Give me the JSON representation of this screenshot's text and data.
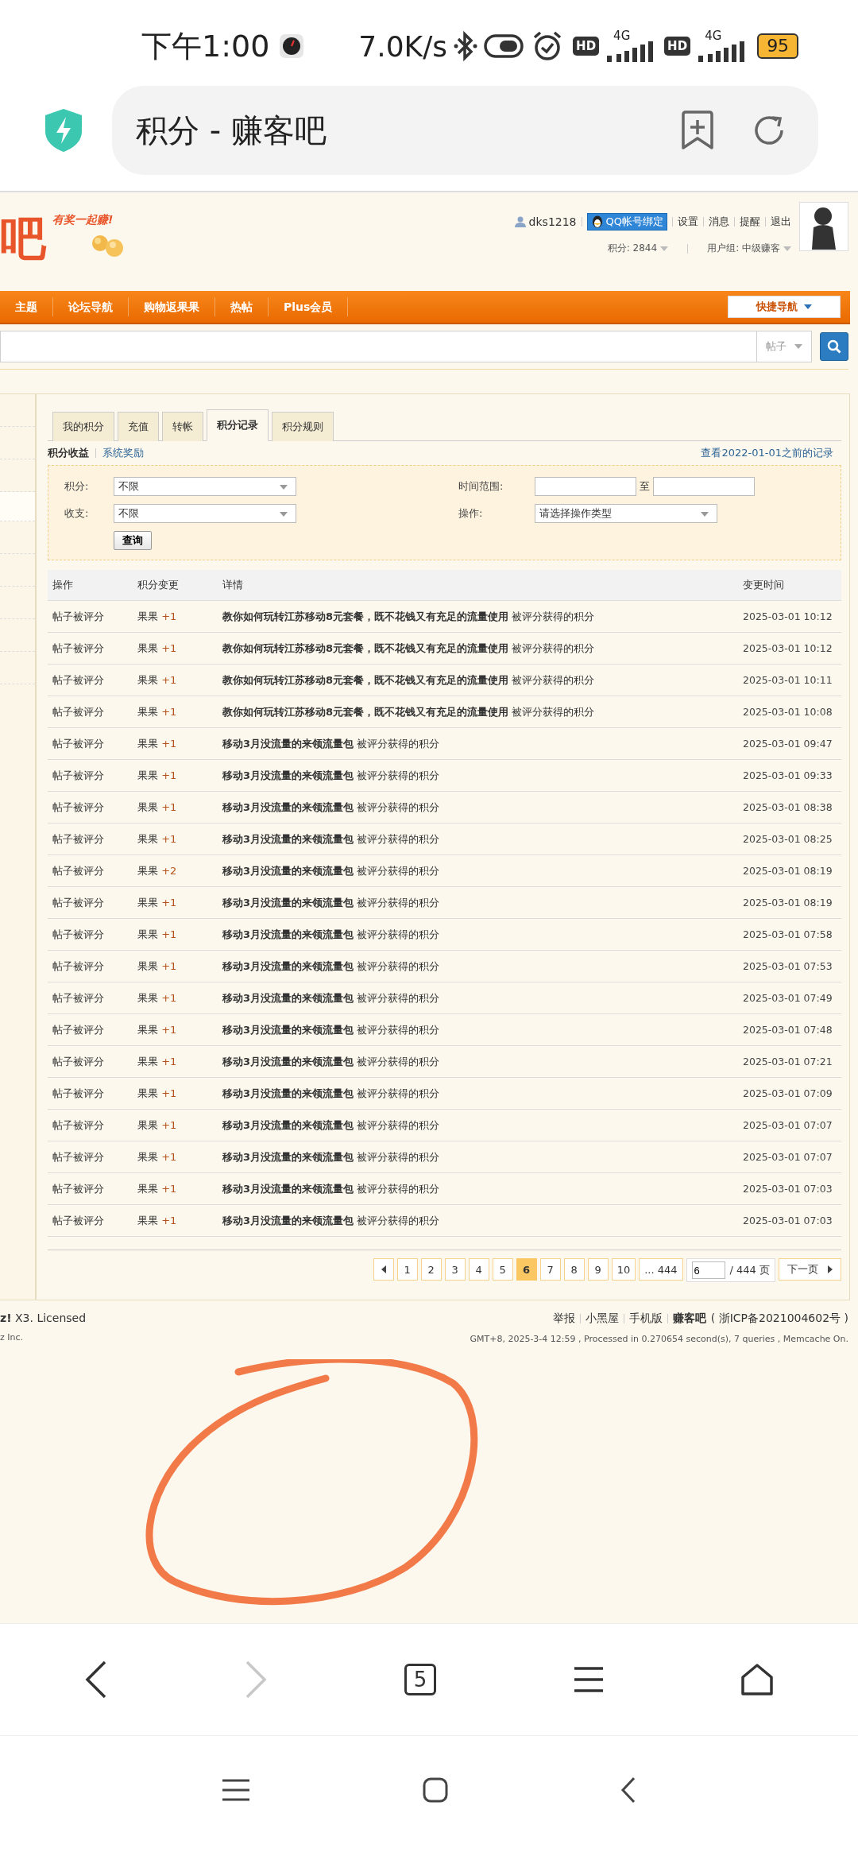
{
  "status_bar": {
    "time": "下午1:00",
    "speed": "7.0K/s",
    "sims": [
      {
        "hd": "HD",
        "net": "4G"
      },
      {
        "hd": "HD",
        "net": "4G"
      }
    ],
    "battery": "95"
  },
  "browser": {
    "title": "积分 - 赚客吧"
  },
  "site_header": {
    "logo_text": "吧",
    "slogan": "有奖一起赚!",
    "username": "dks1218",
    "qq_bind": "QQ帐号绑定",
    "links": [
      "设置",
      "消息",
      "提醒",
      "退出"
    ],
    "points": "积分: 2844",
    "group": "用户组: 中级赚客"
  },
  "nav": {
    "items": [
      "主题",
      "论坛导航",
      "购物返果果",
      "热帖",
      "Plus会员"
    ],
    "quick_nav": "快捷导航"
  },
  "search": {
    "scope": "帖子"
  },
  "tabs": [
    {
      "label": "我的积分",
      "selected": false
    },
    {
      "label": "充值",
      "selected": false
    },
    {
      "label": "转帐",
      "selected": false
    },
    {
      "label": "积分记录",
      "selected": true
    },
    {
      "label": "积分规则",
      "selected": false
    }
  ],
  "subnav": {
    "items": [
      {
        "label": "积分收益",
        "selected": true
      },
      {
        "label": "系统奖励",
        "selected": false
      }
    ],
    "history_link": "查看2022-01-01之前的记录"
  },
  "filters": {
    "credit_label": "积分:",
    "credit_value": "不限",
    "income_label": "收支:",
    "income_value": "不限",
    "time_label": "时间范围:",
    "to": "至",
    "op_label": "操作:",
    "op_value": "请选择操作类型",
    "query": "查询"
  },
  "table": {
    "columns": [
      "操作",
      "积分变更",
      "详情",
      "变更时间"
    ],
    "rows": [
      {
        "operation": "帖子被评分",
        "unit": "果果",
        "amount": "+1",
        "detail": "**教你如何玩转江苏移动8元套餐，既不花钱又有充足的流量使用** 被评分获得的积分",
        "time": "2025-03-01 10:12"
      },
      {
        "operation": "帖子被评分",
        "unit": "果果",
        "amount": "+1",
        "detail": "**教你如何玩转江苏移动8元套餐，既不花钱又有充足的流量使用** 被评分获得的积分",
        "time": "2025-03-01 10:12"
      },
      {
        "operation": "帖子被评分",
        "unit": "果果",
        "amount": "+1",
        "detail": "**教你如何玩转江苏移动8元套餐，既不花钱又有充足的流量使用** 被评分获得的积分",
        "time": "2025-03-01 10:11"
      },
      {
        "operation": "帖子被评分",
        "unit": "果果",
        "amount": "+1",
        "detail": "**教你如何玩转江苏移动8元套餐，既不花钱又有充足的流量使用** 被评分获得的积分",
        "time": "2025-03-01 10:08"
      },
      {
        "operation": "帖子被评分",
        "unit": "果果",
        "amount": "+1",
        "detail": "**移动3月没流量的来领流量包** 被评分获得的积分",
        "time": "2025-03-01 09:47"
      },
      {
        "operation": "帖子被评分",
        "unit": "果果",
        "amount": "+1",
        "detail": "**移动3月没流量的来领流量包** 被评分获得的积分",
        "time": "2025-03-01 09:33"
      },
      {
        "operation": "帖子被评分",
        "unit": "果果",
        "amount": "+1",
        "detail": "**移动3月没流量的来领流量包** 被评分获得的积分",
        "time": "2025-03-01 08:38"
      },
      {
        "operation": "帖子被评分",
        "unit": "果果",
        "amount": "+1",
        "detail": "**移动3月没流量的来领流量包** 被评分获得的积分",
        "time": "2025-03-01 08:25"
      },
      {
        "operation": "帖子被评分",
        "unit": "果果",
        "amount": "+2",
        "detail": "**移动3月没流量的来领流量包** 被评分获得的积分",
        "time": "2025-03-01 08:19"
      },
      {
        "operation": "帖子被评分",
        "unit": "果果",
        "amount": "+1",
        "detail": "**移动3月没流量的来领流量包** 被评分获得的积分",
        "time": "2025-03-01 08:19"
      },
      {
        "operation": "帖子被评分",
        "unit": "果果",
        "amount": "+1",
        "detail": "**移动3月没流量的来领流量包** 被评分获得的积分",
        "time": "2025-03-01 07:58"
      },
      {
        "operation": "帖子被评分",
        "unit": "果果",
        "amount": "+1",
        "detail": "**移动3月没流量的来领流量包** 被评分获得的积分",
        "time": "2025-03-01 07:53"
      },
      {
        "operation": "帖子被评分",
        "unit": "果果",
        "amount": "+1",
        "detail": "**移动3月没流量的来领流量包** 被评分获得的积分",
        "time": "2025-03-01 07:49"
      },
      {
        "operation": "帖子被评分",
        "unit": "果果",
        "amount": "+1",
        "detail": "**移动3月没流量的来领流量包** 被评分获得的积分",
        "time": "2025-03-01 07:48"
      },
      {
        "operation": "帖子被评分",
        "unit": "果果",
        "amount": "+1",
        "detail": "**移动3月没流量的来领流量包** 被评分获得的积分",
        "time": "2025-03-01 07:21"
      },
      {
        "operation": "帖子被评分",
        "unit": "果果",
        "amount": "+1",
        "detail": "**移动3月没流量的来领流量包** 被评分获得的积分",
        "time": "2025-03-01 07:09"
      },
      {
        "operation": "帖子被评分",
        "unit": "果果",
        "amount": "+1",
        "detail": "**移动3月没流量的来领流量包** 被评分获得的积分",
        "time": "2025-03-01 07:07"
      },
      {
        "operation": "帖子被评分",
        "unit": "果果",
        "amount": "+1",
        "detail": "**移动3月没流量的来领流量包** 被评分获得的积分",
        "time": "2025-03-01 07:07"
      },
      {
        "operation": "帖子被评分",
        "unit": "果果",
        "amount": "+1",
        "detail": "**移动3月没流量的来领流量包** 被评分获得的积分",
        "time": "2025-03-01 07:03"
      },
      {
        "operation": "帖子被评分",
        "unit": "果果",
        "amount": "+1",
        "detail": "**移动3月没流量的来领流量包** 被评分获得的积分",
        "time": "2025-03-01 07:03"
      }
    ]
  },
  "pagination": {
    "pages": [
      {
        "label": "1",
        "selected": false
      },
      {
        "label": "2",
        "selected": false
      },
      {
        "label": "3",
        "selected": false
      },
      {
        "label": "4",
        "selected": false
      },
      {
        "label": "5",
        "selected": false
      },
      {
        "label": "6",
        "selected": true
      },
      {
        "label": "7",
        "selected": false
      },
      {
        "label": "8",
        "selected": false
      },
      {
        "label": "9",
        "selected": false
      },
      {
        "label": "10",
        "selected": false
      }
    ],
    "last": "... 444",
    "input": "6",
    "total": "/ 444 页",
    "next": "下一页"
  },
  "footer": {
    "powered": "**z!** X3. Licensed",
    "company": "z Inc.",
    "links": [
      "举报",
      "小黑屋",
      "手机版"
    ],
    "site": "赚客吧",
    "icp": "( 浙ICP备2021004602号 )",
    "stats": "GMT+8, 2025-3-4 12:59 , Processed in 0.270654 second(s), 7 queries , Memcache On."
  },
  "browser_toolbar": {
    "tab_count": "5",
    "forward_disabled": true
  },
  "annotation": {
    "kind": "circle"
  }
}
